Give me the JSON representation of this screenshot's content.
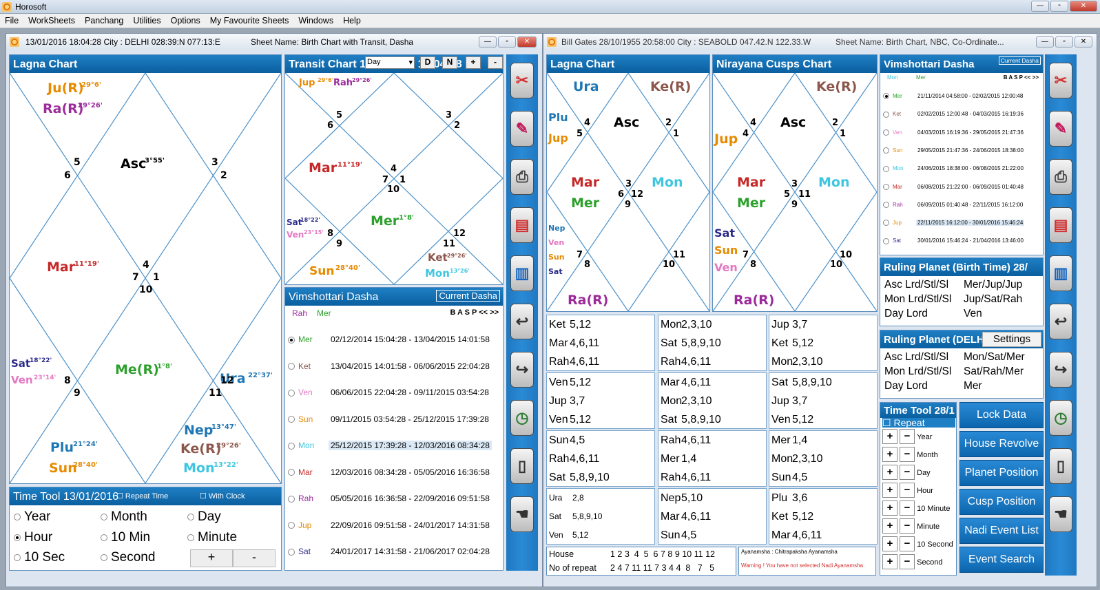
{
  "app": {
    "title": "Horosoft",
    "menu": [
      "File",
      "WorkSheets",
      "Panchang",
      "Utilities",
      "Options",
      "My Favourite Sheets",
      "Windows",
      "Help"
    ]
  },
  "left": {
    "header": "13/01/2016 18:04:28  City : DELHI 028:39:N 077:13:E",
    "sheet": "Sheet Name: Birth Chart with Transit, Dasha",
    "lagna": {
      "title": "Lagna Chart",
      "planets": [
        "Ju(R)",
        "29°6'",
        "Ra(R)",
        "29°26'",
        "Asc",
        "3°55'",
        "Mar",
        "11°19'",
        "Sat",
        "18°22'",
        "Ven",
        "23°14'",
        "Me(R)",
        "1°8'",
        "Ura",
        "22°37'",
        "Nep",
        "13°47'",
        "Ke(R)",
        "29°26'",
        "Plu",
        "21°24'",
        "Sun",
        "28°40'",
        "Mon",
        "13°22'"
      ],
      "nums": [
        "5",
        "6",
        "3",
        "2",
        "4",
        "7",
        "1",
        "10",
        "8",
        "9",
        "12",
        "11"
      ]
    },
    "transit": {
      "title": "Transit Chart 13/01/2016 18:04:28",
      "select": "Day",
      "btns": [
        "D",
        "N",
        "+",
        "-"
      ],
      "planets": [
        "Jup",
        "29°6'",
        "Rah",
        "29°26'",
        "Mar",
        "11°19'",
        "Mer",
        "1°8'",
        "Sat",
        "18°22'",
        "Ven",
        "23°15'",
        "Sun",
        "28°40'",
        "Ket",
        "29°26'",
        "Mon",
        "13°26'"
      ],
      "nums": [
        "5",
        "6",
        "3",
        "2",
        "4",
        "7",
        "1",
        "10",
        "8",
        "9",
        "12",
        "11"
      ]
    },
    "dasha": {
      "title": "Vimshottari Dasha",
      "current": "Current Dasha",
      "lord1": "Rah",
      "lord2": "Mer",
      "nav": "B A S P  <<  >>",
      "rows": [
        [
          "Mer",
          "02/12/2014 15:04:28 - 13/04/2015 14:01:58"
        ],
        [
          "Ket",
          "13/04/2015 14:01:58 - 06/06/2015 22:04:28"
        ],
        [
          "Ven",
          "06/06/2015 22:04:28 - 09/11/2015 03:54:28"
        ],
        [
          "Sun",
          "09/11/2015 03:54:28 - 25/12/2015 17:39:28"
        ],
        [
          "Mon",
          "25/12/2015 17:39:28 - 12/03/2016 08:34:28"
        ],
        [
          "Mar",
          "12/03/2016 08:34:28 - 05/05/2016 16:36:58"
        ],
        [
          "Rah",
          "05/05/2016 16:36:58 - 22/09/2016 09:51:58"
        ],
        [
          "Jup",
          "22/09/2016 09:51:58 - 24/01/2017 14:31:58"
        ],
        [
          "Sat",
          "24/01/2017 14:31:58 - 21/06/2017 02:04:28"
        ]
      ]
    },
    "timetool": {
      "title": "Time Tool 13/01/2016",
      "repeat": "Repeat Time",
      "clock": "With Clock",
      "options": [
        "Year",
        "Month",
        "Day",
        "Hour",
        "10 Min",
        "Minute",
        "10 Sec",
        "Second"
      ],
      "plus": "+",
      "minus": "-"
    }
  },
  "right": {
    "header": "Bill Gates 28/10/1955 20:58:00  City : SEABOLD 047.42.N 122.33.W",
    "sheet": "Sheet Name: Birth Chart, NBC, Co-Ordinate...",
    "lagna": {
      "title": "Lagna Chart",
      "planets": [
        "Ura",
        "Ke(R)",
        "Plu",
        "Jup",
        "Asc",
        "Mar",
        "Mer",
        "Mon",
        "Nep",
        "Ven",
        "Sun",
        "Sat",
        "Ra(R)"
      ],
      "nums": [
        "4",
        "5",
        "2",
        "1",
        "3",
        "6",
        "12",
        "9",
        "7",
        "8",
        "11",
        "10"
      ]
    },
    "cusps": {
      "title": "Nirayana Cusps Chart",
      "planets": [
        "Ke(R)",
        "Jup",
        "Asc",
        "Mar",
        "Mer",
        "Mon",
        "Sat",
        "Sun",
        "Ven",
        "Ra(R)"
      ],
      "nums": [
        "4",
        "4",
        "2",
        "1",
        "3",
        "5",
        "11",
        "9",
        "7",
        "8",
        "10",
        "10"
      ]
    },
    "dasha": {
      "title": "Vimshottari Dasha",
      "current": "Current Dasha",
      "lord1": "Mon",
      "lord2": "Mer",
      "nav": "B A S P << >>",
      "rows": [
        [
          "Mer",
          "21/11/2014 04:58:00 - 02/02/2015 12:00:48"
        ],
        [
          "Ket",
          "02/02/2015 12:00:48 - 04/03/2015 16:19:36"
        ],
        [
          "Ven",
          "04/03/2015 16:19:36 - 29/05/2015 21:47:36"
        ],
        [
          "Sun",
          "29/05/2015 21:47:36 - 24/06/2015 18:38:00"
        ],
        [
          "Mon",
          "24/06/2015 18:38:00 - 06/08/2015 21:22:00"
        ],
        [
          "Mar",
          "06/08/2015 21:22:00 - 06/09/2015 01:40:48"
        ],
        [
          "Rah",
          "06/09/2015 01:40:48 - 22/11/2015 16:12:00"
        ],
        [
          "Jup",
          "22/11/2015 16:12:00 - 30/01/2016 15:46:24"
        ],
        [
          "Sat",
          "30/01/2016 15:46:24 - 21/04/2016 13:46:00"
        ]
      ]
    },
    "ruling1": {
      "title": "Ruling Planet (Birth Time) 28/",
      "rows": [
        [
          "Asc Lrd/Stl/Sl",
          "Mer/Jup/Jup"
        ],
        [
          "Mon Lrd/Stl/Sl",
          "Jup/Sat/Rah"
        ],
        [
          "Day Lord",
          "Ven"
        ]
      ]
    },
    "ruling2": {
      "title": "Ruling Planet (DELH",
      "settings": "Settings",
      "rows": [
        [
          "Asc Lrd/Stl/Sl",
          "Mon/Sat/Mer"
        ],
        [
          "Mon Lrd/Stl/Sl",
          "Sat/Rah/Mer"
        ],
        [
          "Day Lord",
          "Mer"
        ]
      ]
    },
    "timetool": {
      "title": "Time Tool 28/1",
      "repeat": "Repeat",
      "items": [
        "Year",
        "Month",
        "Day",
        "Hour",
        "10 Minute",
        "Minute",
        "10 Second",
        "Second"
      ]
    },
    "actions": [
      "Lock Data",
      "House Revolve",
      "Planet Position",
      "Cusp Position",
      "Nadi Event List",
      "Event Search"
    ],
    "cells": [
      [
        [
          "Ket",
          "5,12"
        ],
        [
          "Mar",
          "4,6,11"
        ],
        [
          "Rah",
          "4,6,11"
        ]
      ],
      [
        [
          "Mon",
          "2,3,10"
        ],
        [
          "Sat",
          "5,8,9,10"
        ],
        [
          "Rah",
          "4,6,11"
        ]
      ],
      [
        [
          "Jup",
          "3,7"
        ],
        [
          "Ket",
          "5,12"
        ],
        [
          "Mon",
          "2,3,10"
        ]
      ],
      [
        [
          "Ven",
          "5,12"
        ],
        [
          "Jup",
          "3,7"
        ],
        [
          "Ven",
          "5,12"
        ]
      ],
      [
        [
          "Mar",
          "4,6,11"
        ],
        [
          "Mon",
          "2,3,10"
        ],
        [
          "Sat",
          "5,8,9,10"
        ]
      ],
      [
        [
          "Sat",
          "5,8,9,10"
        ],
        [
          "Jup",
          "3,7"
        ],
        [
          "Ven",
          "5,12"
        ]
      ],
      [
        [
          "Sun",
          "4,5"
        ],
        [
          "Rah",
          "4,6,11"
        ],
        [
          "Sat",
          "5,8,9,10"
        ]
      ],
      [
        [
          "Rah",
          "4,6,11"
        ],
        [
          "Mer",
          "1,4"
        ],
        [
          "Rah",
          "4,6,11"
        ]
      ],
      [
        [
          "Mer",
          "1,4"
        ],
        [
          "Mon",
          "2,3,10"
        ],
        [
          "Sun",
          "4,5"
        ]
      ],
      [
        [
          "Ura",
          "2,8"
        ],
        [
          "Sat",
          "5,8,9,10"
        ],
        [
          "Ven",
          "5,12"
        ]
      ],
      [
        [
          "Nep",
          "5,10"
        ],
        [
          "Mar",
          "4,6,11"
        ],
        [
          "Sun",
          "4,5"
        ]
      ],
      [
        [
          "Plu",
          "3,6"
        ],
        [
          "Ket",
          "5,12"
        ],
        [
          "Mar",
          "4,6,11"
        ]
      ]
    ],
    "house": {
      "label": "House",
      "values": "1 2 3  4  5  6 7 8 9 10 11 12",
      "repeat_label": "No of repeat",
      "repeat_values": "2 4 7 11 11 7 3 4 4  8   7   5"
    },
    "ayanamsha": "Ayanamsha : Chitrapaksha Ayanamsha",
    "warning": "Warning ! You have not selected Nadi Ayanamsha."
  }
}
